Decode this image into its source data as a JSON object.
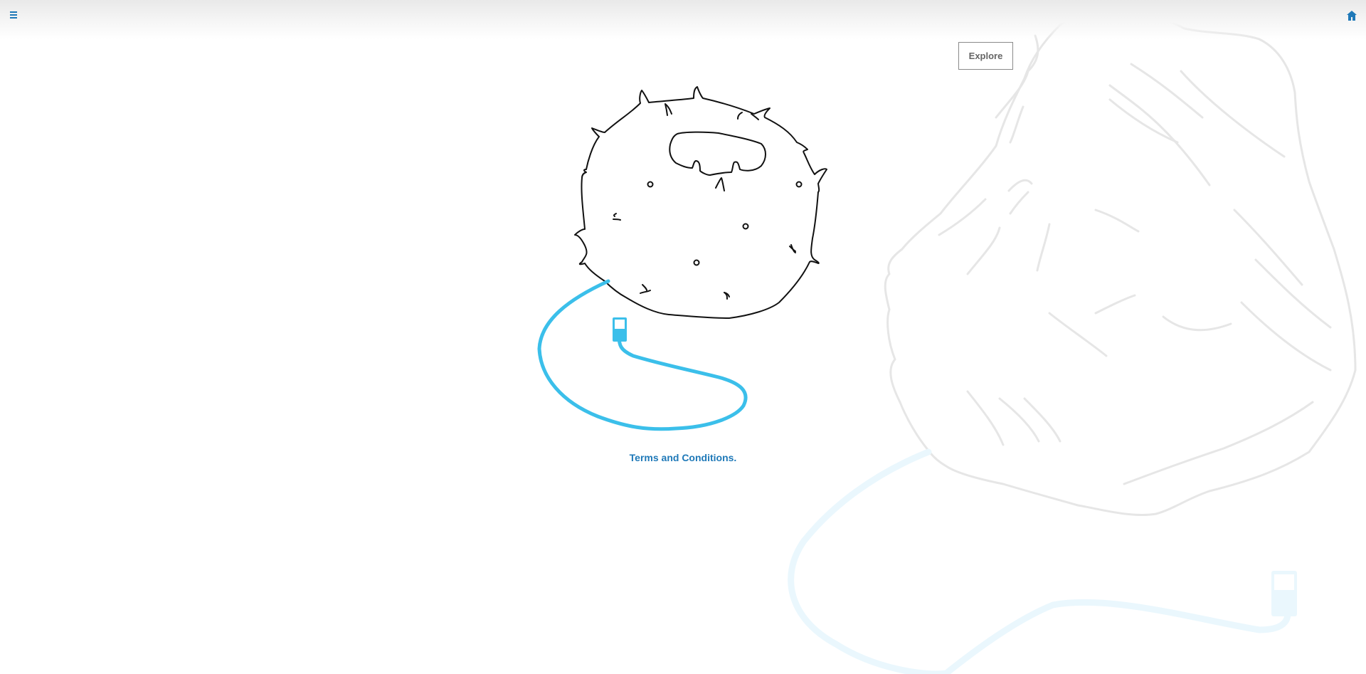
{
  "header": {
    "menu_icon": "hamburger-menu-icon",
    "home_icon": "home-icon"
  },
  "explore_button": {
    "label": "Explore"
  },
  "illustration": {
    "subject": "hand-drawn spiky cell connected to a blue cable and plug",
    "background_subject": "faded large hand-drawn cell with blue cable"
  },
  "footer_link": {
    "label": "Terms and Conditions."
  },
  "colors": {
    "accent_blue": "#1f79b8",
    "cable_blue": "#3bbfea",
    "line_black": "#111111",
    "faded_gray": "#dcdcdc",
    "faded_cable": "#eaf7fd"
  }
}
